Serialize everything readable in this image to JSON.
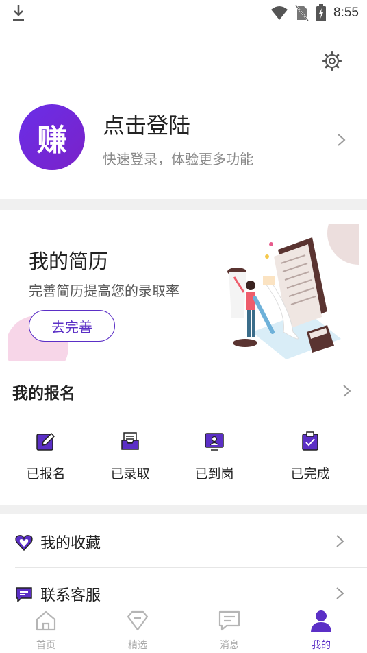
{
  "status_bar": {
    "time": "8:55"
  },
  "profile": {
    "avatar_text": "赚",
    "title": "点击登陆",
    "subtitle": "快速登录，体验更多功能"
  },
  "resume": {
    "title": "我的简历",
    "subtitle": "完善简历提高您的录取率",
    "button": "去完善"
  },
  "signup": {
    "title": "我的报名",
    "items": [
      {
        "label": "已报名",
        "icon": "edit-icon"
      },
      {
        "label": "已录取",
        "icon": "inbox-icon"
      },
      {
        "label": "已到岗",
        "icon": "badge-icon"
      },
      {
        "label": "已完成",
        "icon": "clipboard-check-icon"
      }
    ]
  },
  "menu": [
    {
      "label": "我的收藏",
      "icon": "heart-icon"
    },
    {
      "label": "联系客服",
      "icon": "chat-icon"
    }
  ],
  "tabs": [
    {
      "label": "首页",
      "icon": "home-icon"
    },
    {
      "label": "精选",
      "icon": "diamond-icon"
    },
    {
      "label": "消息",
      "icon": "message-icon"
    },
    {
      "label": "我的",
      "icon": "user-icon",
      "active": true
    }
  ],
  "colors": {
    "accent": "#5b2fc6",
    "avatar": "#6a2ee8",
    "divider": "#f0f0f0"
  }
}
